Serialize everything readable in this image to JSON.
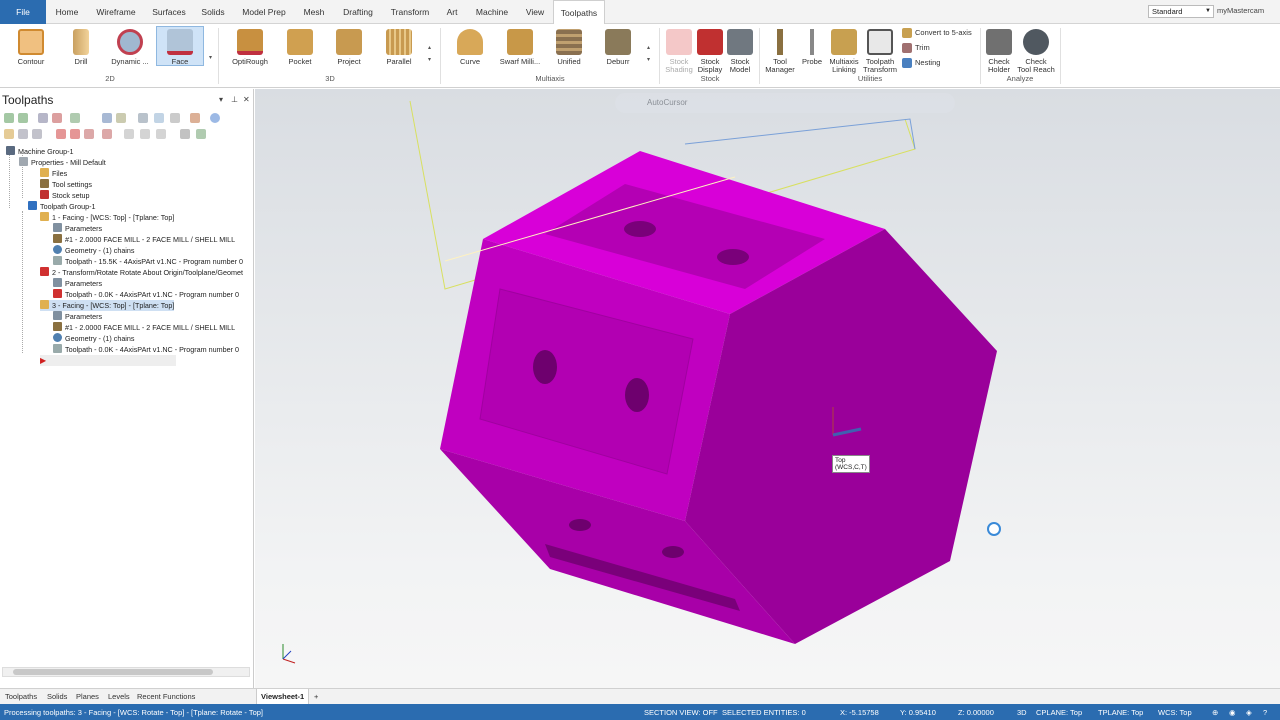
{
  "menu": {
    "tabs": [
      "File",
      "Home",
      "Wireframe",
      "Surfaces",
      "Solids",
      "Model Prep",
      "Mesh",
      "Drafting",
      "Transform",
      "Art",
      "Machine",
      "View",
      "Toolpaths"
    ],
    "active": "Toolpaths",
    "standard": "Standard",
    "account": "myMastercam"
  },
  "ribbon": {
    "buttons": {
      "contour": "Contour",
      "drill": "Drill",
      "dynamic": "Dynamic ...",
      "face": "Face",
      "optirough": "OptiRough",
      "pocket": "Pocket",
      "project": "Project",
      "parallel": "Parallel",
      "curve": "Curve",
      "swarf": "Swarf Milli...",
      "unified": "Unified",
      "deburr": "Deburr",
      "stock_shading": "Stock\nShading",
      "stock_display": "Stock\nDisplay",
      "stock_model": "Stock\nModel",
      "tool_manager": "Tool\nManager",
      "probe": "Probe",
      "multiaxis_linking": "Multiaxis\nLinking",
      "toolpath_transform": "Toolpath\nTransform",
      "check_holder": "Check\nHolder",
      "check_tool_reach": "Check\nTool Reach"
    },
    "small": {
      "convert": "Convert to 5-axis",
      "trim": "Trim",
      "nesting": "Nesting"
    },
    "groups": {
      "g2d": "2D",
      "g3d": "3D",
      "multiaxis": "Multiaxis",
      "stock": "Stock",
      "utilities": "Utilities",
      "analyze": "Analyze"
    }
  },
  "panel": {
    "title": "Toolpaths",
    "tree": [
      "Machine Group-1",
      "Properties - Mill Default",
      "Files",
      "Tool settings",
      "Stock setup",
      "Toolpath Group-1",
      "1 - Facing - [WCS: Top] - [Tplane: Top]",
      "Parameters",
      "#1 - 2.0000 FACE MILL - 2 FACE MILL / SHELL MILL",
      "Geometry - (1) chains",
      "Toolpath - 15.5K - 4AxisPArt v1.NC - Program number 0",
      "2 - Transform/Rotate Rotate About Origin/Toolplane/Geomet",
      "Parameters",
      "Toolpath - 0.0K - 4AxisPArt v1.NC - Program number 0",
      "3 - Facing - [WCS: Top] - [Tplane: Top]",
      "Parameters",
      "#1 - 2.0000 FACE MILL - 2 FACE MILL / SHELL MILL",
      "Geometry - (1) chains",
      "Toolpath - 0.0K - 4AxisPArt v1.NC - Program number 0"
    ]
  },
  "viewport": {
    "autocursor": "AutoCursor",
    "tag_line1": "Top",
    "tag_line2": "(WCS,C,T)",
    "part_color": "#c800c8"
  },
  "bottom": {
    "tabs": [
      "Toolpaths",
      "Solids",
      "Planes",
      "Levels",
      "Recent Functions"
    ],
    "viewsheet": "Viewsheet-1",
    "add": "+"
  },
  "status": {
    "message": "Processing toolpaths: 3 - Facing - [WCS: Rotate - Top] - [Tplane: Rotate - Top]",
    "section_view": "SECTION VIEW: OFF",
    "selected": "SELECTED ENTITIES: 0",
    "x": "X:   -5.15758",
    "y": "Y:   0.95410",
    "z": "Z:   0.00000",
    "mode": "3D",
    "cplane": "CPLANE: Top",
    "tplane": "TPLANE: Top",
    "wcs": "WCS: Top"
  }
}
